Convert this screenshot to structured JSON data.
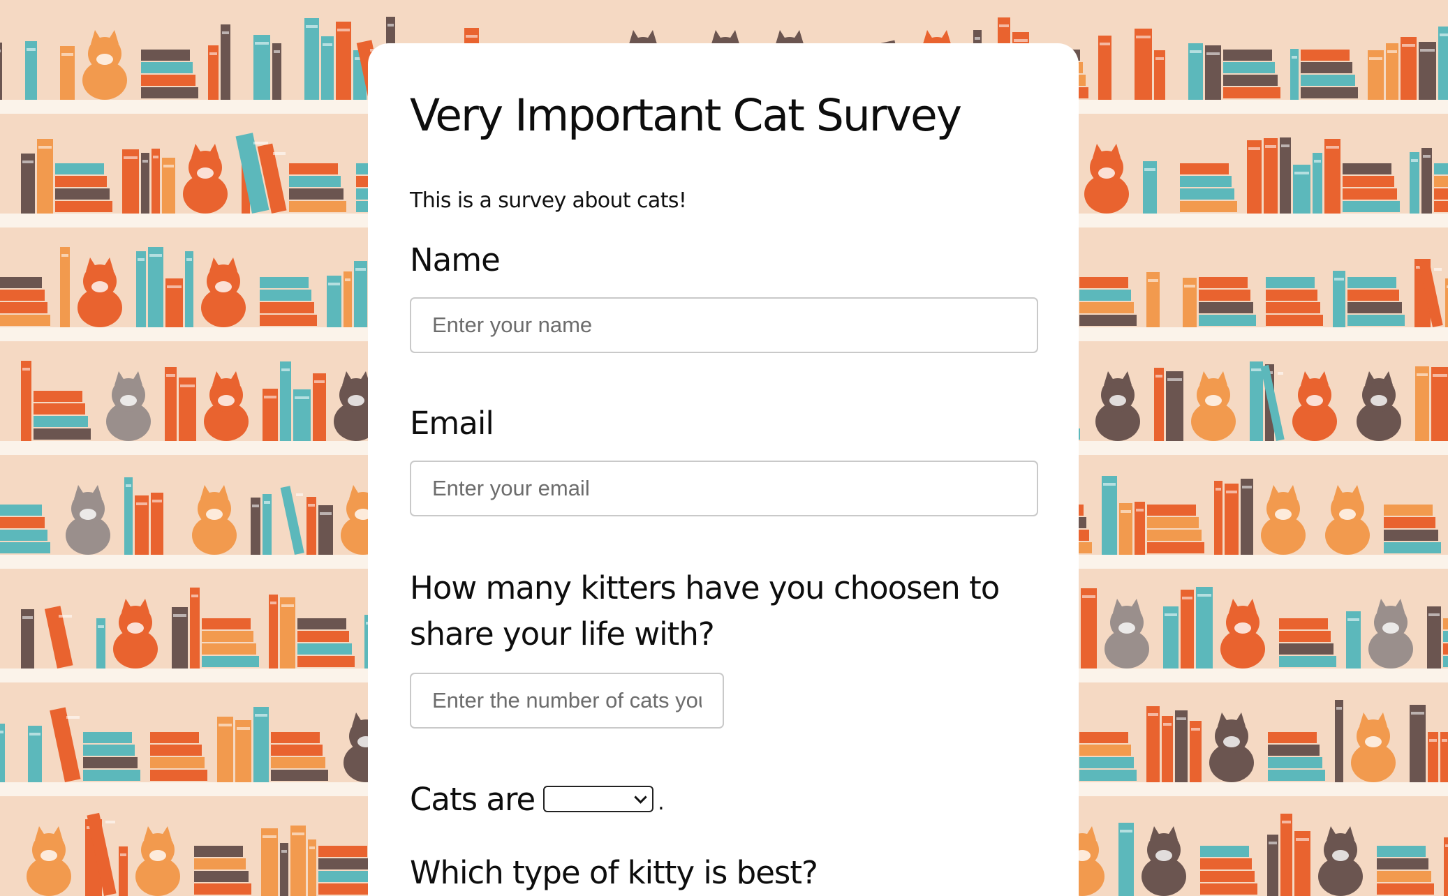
{
  "survey": {
    "title": "Very Important Cat Survey",
    "description": "This is a survey about cats!",
    "name_label": "Name",
    "name_placeholder": "Enter your name",
    "email_label": "Email",
    "email_placeholder": "Enter your email",
    "kitties_question": "How many kitters have you choosen to share your life with?",
    "kitties_placeholder": "Enter the number of cats you have",
    "cats_are_label": "Cats are",
    "cats_are_selected": "",
    "cats_are_suffix": ".",
    "best_kitty_question": "Which type of kitty is best?"
  },
  "colors": {
    "background": "#f5d9c3",
    "card": "#ffffff",
    "shelf": "#fbf3ea",
    "book_orange": "#e9632f",
    "book_teal": "#5cb8bb",
    "book_brown": "#6b5550",
    "book_light_orange": "#f29a4e"
  }
}
